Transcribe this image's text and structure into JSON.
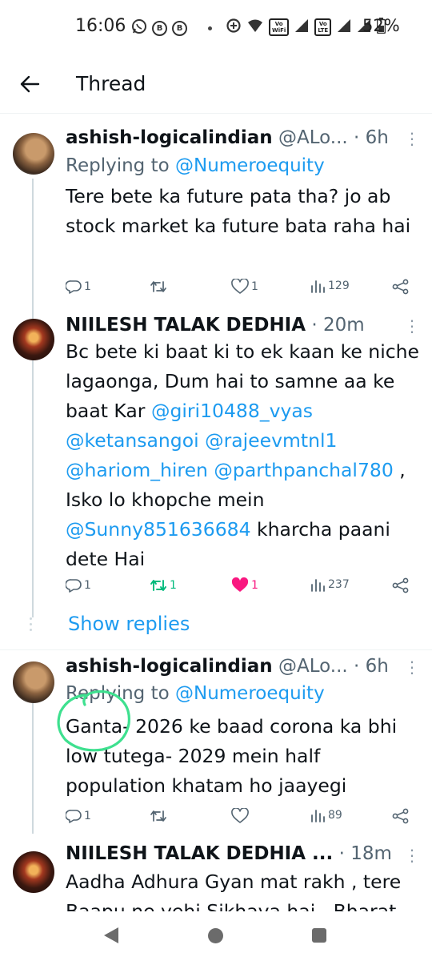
{
  "status_bar": {
    "time": "16:06",
    "battery": "52%",
    "net1": "Vo WiFi",
    "net2": "Vo LTE"
  },
  "header": {
    "title": "Thread"
  },
  "tweets": [
    {
      "name": "ashish-logicalindian",
      "handle": "@ALo...",
      "time": "· 6h",
      "replying_prefix": "Replying to ",
      "replying_to": "@Numeroequity",
      "text": "Tere bete ka future pata tha? jo ab stock market ka future bata raha hai",
      "replies": "1",
      "retweets": "",
      "likes": "1",
      "views": "129"
    },
    {
      "name": "NIILESH TALAK DEDHIA",
      "time": "· 20m",
      "text_segments": [
        {
          "t": "Bc bete ki baat ki to ek kaan ke niche lagaonga, Dum hai to samne aa ke baat Kar  ",
          "mention": false
        },
        {
          "t": "@giri10488_vyas",
          "mention": true
        },
        {
          "t": " ",
          "mention": false
        },
        {
          "t": "@ketansangoi",
          "mention": true
        },
        {
          "t": " ",
          "mention": false
        },
        {
          "t": "@rajeevmtnl1",
          "mention": true
        },
        {
          "t": " ",
          "mention": false
        },
        {
          "t": "@hariom_hiren",
          "mention": true
        },
        {
          "t": " ",
          "mention": false
        },
        {
          "t": "@parthpanchal780",
          "mention": true
        },
        {
          "t": " , Isko lo khopche mein ",
          "mention": false
        },
        {
          "t": "@Sunny851636684",
          "mention": true
        },
        {
          "t": "  kharcha paani dete Hai",
          "mention": false
        }
      ],
      "replies": "1",
      "retweets": "1",
      "likes": "1",
      "views": "237"
    },
    {
      "name": "ashish-logicalindian",
      "handle": "@ALo...",
      "time": "· 6h",
      "replying_prefix": "Replying to ",
      "replying_to": "@Numeroequity",
      "text": "Ganta- 2026 ke baad corona ka bhi low tutega- 2029 mein half population khatam ho jaayegi",
      "replies": "1",
      "retweets": "",
      "likes": "",
      "views": "89"
    },
    {
      "name": "NIILESH TALAK DEDHIA ...",
      "time": "· 18m",
      "text": "Aadha Adhura Gyan mat rakh , tere Baapu ne yehi Sikhaya hai , Bharat"
    }
  ],
  "show_replies": "Show replies",
  "colors": {
    "link": "#1d9bf0",
    "retweet_active": "#00ba7c",
    "like_active": "#f91880",
    "annotation": "#3ee08f"
  },
  "icons": [
    "back-arrow-icon",
    "reply-icon",
    "retweet-icon",
    "heart-icon",
    "views-icon",
    "share-icon",
    "more-icon"
  ]
}
